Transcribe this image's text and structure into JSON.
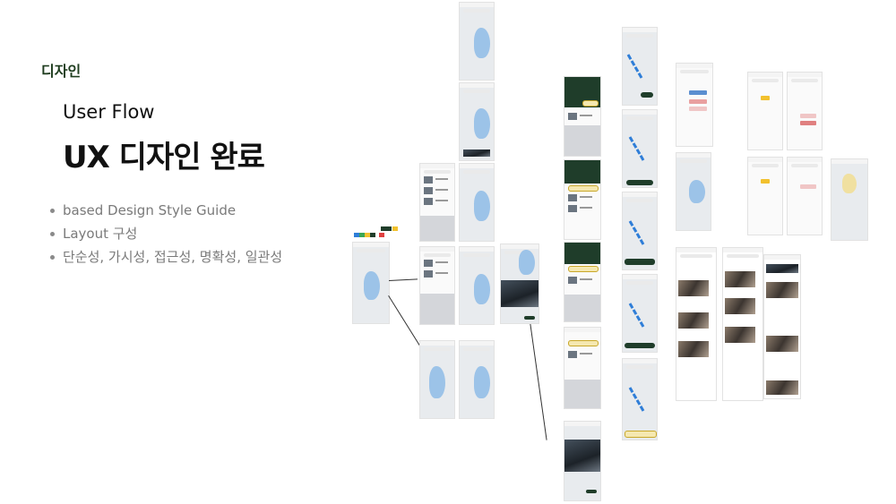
{
  "section_tag": "디자인",
  "flow_title": "User Flow",
  "main_title": "UX 디자인 완료",
  "bullets": [
    "based Design Style Guide",
    "Layout 구성",
    "단순성, 가시성, 접근성, 명확성, 일관성"
  ],
  "colors": {
    "title_green": "#1f3d1f",
    "brand_green": "#1f3d2a",
    "map_water": "#9cc3e8",
    "route_blue": "#2f7ed8",
    "highlight_yellow": "#f5e8b0",
    "palette": [
      "#1f3d2a",
      "#f2c12e",
      "#2f7ed8",
      "#3aa655",
      "#e04040"
    ]
  }
}
